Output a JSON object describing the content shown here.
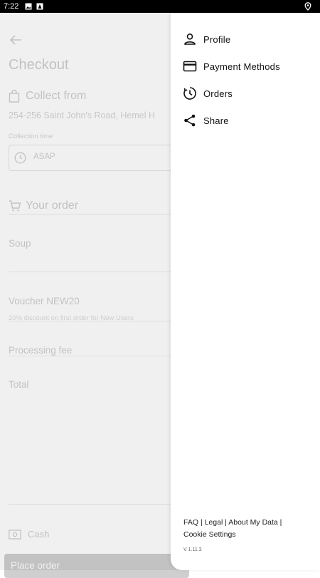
{
  "status_bar": {
    "time": "7:22"
  },
  "checkout": {
    "title": "Checkout",
    "collect_from_label": "Collect from",
    "address": "254-256 Saint John's Road, Hemel H",
    "collection_time_label": "Collection time",
    "collection_time_value": "ASAP",
    "your_order_label": "Your order",
    "items": [
      "Soup"
    ],
    "voucher_label": "Voucher NEW20",
    "voucher_desc": "20% discount on first order for New Users",
    "processing_fee_label": "Processing fee",
    "total_label": "Total",
    "payment_method": "Cash",
    "place_order_label": "Place order"
  },
  "drawer": {
    "menu": [
      {
        "label": "Profile",
        "icon": "person-icon"
      },
      {
        "label": "Payment Methods",
        "icon": "credit-card-icon"
      },
      {
        "label": "Orders",
        "icon": "history-icon"
      },
      {
        "label": "Share",
        "icon": "share-icon"
      }
    ],
    "footer_links": [
      "FAQ",
      "Legal",
      "About My Data",
      "Cookie Settings"
    ],
    "footer_separator": "|",
    "version": "V 1.11.3"
  }
}
